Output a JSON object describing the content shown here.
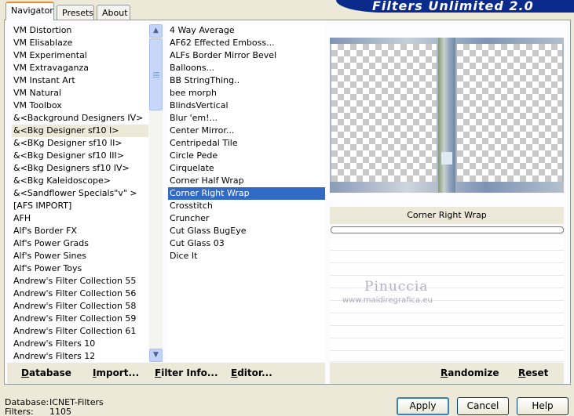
{
  "tabs": [
    "Navigator",
    "Presets",
    "About"
  ],
  "header": {
    "title": "Filters Unlimited 2.0"
  },
  "categories": {
    "items": [
      "VM Distortion",
      "VM Elisablaze",
      "VM Experimental",
      "VM Extravaganza",
      "VM Instant Art",
      "VM Natural",
      "VM Toolbox",
      "&<Background Designers IV>",
      "&<Bkg Designer sf10 I>",
      "&<BKg Designer sf10 II>",
      "&<Bkg Designer sf10 III>",
      "&<Bkg Designers sf10 IV>",
      "&<Bkg Kaleidoscope>",
      "&<Sandflower Specials\"v\" >",
      "[AFS IMPORT]",
      "AFH",
      "Alf's Border FX",
      "Alf's Power Grads",
      "Alf's Power Sines",
      "Alf's Power Toys",
      "Andrew's Filter Collection 55",
      "Andrew's Filter Collection 56",
      "Andrew's Filter Collection 58",
      "Andrew's Filter Collection 59",
      "Andrew's Filter Collection 61",
      "Andrew's Filters 10",
      "Andrew's Filters 12"
    ],
    "selected_index": 8
  },
  "filters": {
    "items": [
      "4 Way Average",
      "AF62 Effected Emboss...",
      "ALFs Border Mirror Bevel",
      "Balloons...",
      "BB StringThing..",
      "bee morph",
      "BlindsVertical",
      "Blur 'em!...",
      "Center Mirror...",
      "Centripedal Tile",
      "Circle Pede",
      "Cirquelate",
      "Corner Half Wrap",
      "Corner Right Wrap",
      "Crosstitch",
      "Cruncher",
      "Cut Glass  BugEye",
      "Cut Glass 03",
      "Dice It"
    ],
    "selected_index": 13
  },
  "left_toolbar": {
    "database": "Database",
    "import": "Import...",
    "filter_info": "Filter Info...",
    "editor": "Editor..."
  },
  "right_toolbar": {
    "randomize": "Randomize",
    "reset": "Reset"
  },
  "preview": {
    "filter_name": "Corner Right Wrap"
  },
  "watermark": {
    "name": "Pinuccia",
    "url": "www.maidiregrafica.eu"
  },
  "status": {
    "database_label": "Database:",
    "database_value": "ICNET-Filters",
    "filters_label": "Filters:",
    "filters_value": "1105"
  },
  "dialog": {
    "apply": "Apply",
    "cancel": "Cancel",
    "help": "Help"
  }
}
